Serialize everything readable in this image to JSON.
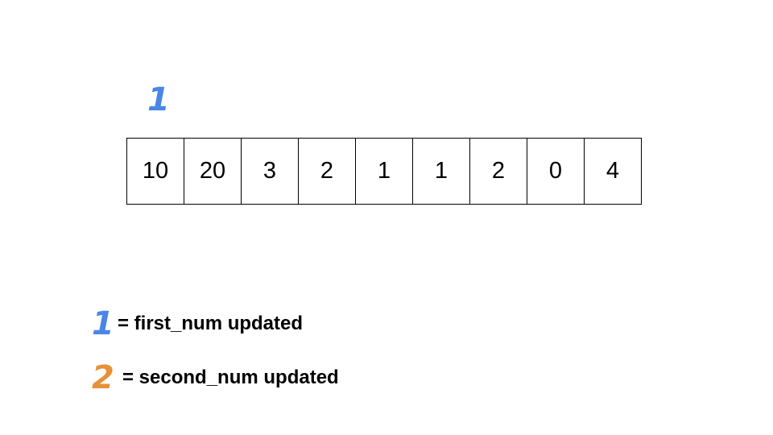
{
  "pointer_marker": {
    "label": "1",
    "color": "#4a86e8"
  },
  "array": {
    "cells": [
      "10",
      "20",
      "3",
      "2",
      "1",
      "1",
      "2",
      "0",
      "4"
    ]
  },
  "legend": [
    {
      "marker": "1",
      "color": "#4a86e8",
      "text": "= first_num updated"
    },
    {
      "marker": "2",
      "color": "#e69138",
      "text": "= second_num updated"
    }
  ]
}
